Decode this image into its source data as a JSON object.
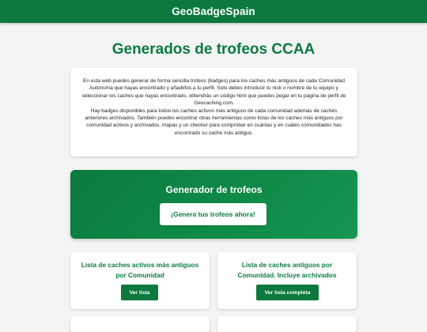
{
  "header": {
    "brand": "GeoBadgeSpain"
  },
  "main": {
    "title": "Generados de trofeos CCAA",
    "intro": {
      "paragraph1": "En esta web puedes generar de forma sencilla trofeos (badges) para los caches más antiguos de cada Comunidad Autónoma que hayas encontrado y añadirlos a tu perfil. Solo debes introducir tu nick o nombre de tu equipo y seleccionar los caches que hayas encontrado, obtendrás un código html que puedes pegar en tu página de perfil de Geocaching.com.",
      "paragraph2": "Hay badges disponibles para todos los caches activos más antiguos de cada comunidad además de cachés anteriores archivados. También puedes encontrar otras herramientas como listas de los caches más antiguos por comunidad activos y archivados, mapas y un checker para comprobar en cuántas y en cuáles comunidades has encontrado su caché más antiguo."
    },
    "generator": {
      "title": "Generador de trofeos",
      "button_label": "¡Genera tus trofeos ahora!"
    },
    "tools": [
      {
        "title": "Lista de caches activos más antiguos por Comunidad",
        "button_label": "Ver lista"
      },
      {
        "title": "Lista de caches antiguos por Comunidad. Incluye archivados",
        "button_label": "Ver lista completa"
      }
    ]
  },
  "colors": {
    "primary": "#0c7a3f",
    "background": "#f3f4f4",
    "card": "#ffffff"
  }
}
